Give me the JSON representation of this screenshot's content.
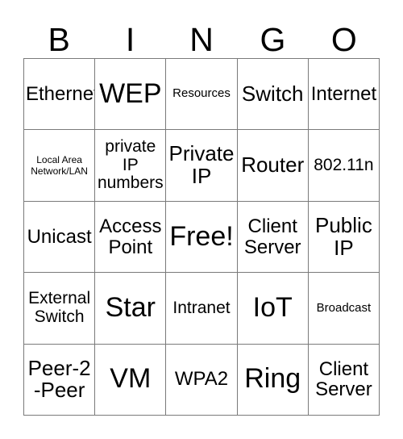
{
  "card": {
    "title_letters": [
      "B",
      "I",
      "N",
      "G",
      "O"
    ],
    "columns": 5,
    "rows": 5,
    "free_space_label": "Free!",
    "grid": [
      [
        {
          "text": "Ethernet",
          "size": "fs-lg"
        },
        {
          "text": "WEP",
          "size": "fs-xxl"
        },
        {
          "text": "Resources",
          "size": "fs-sm"
        },
        {
          "text": "Switch",
          "size": "fs-xl"
        },
        {
          "text": "Internet",
          "size": "fs-lg"
        }
      ],
      [
        {
          "text": "Local Area\nNetwork/LAN",
          "size": "fs-xs"
        },
        {
          "text": "private\nIP\nnumbers",
          "size": "fs-md"
        },
        {
          "text": "Private\nIP",
          "size": "fs-xl"
        },
        {
          "text": "Router",
          "size": "fs-xl"
        },
        {
          "text": "802.11n",
          "size": "fs-md"
        }
      ],
      [
        {
          "text": "Unicast",
          "size": "fs-lg"
        },
        {
          "text": "Access\nPoint",
          "size": "fs-lg"
        },
        {
          "text": "Free!",
          "size": "fs-xxl"
        },
        {
          "text": "Client\nServer",
          "size": "fs-lg"
        },
        {
          "text": "Public\nIP",
          "size": "fs-xl"
        }
      ],
      [
        {
          "text": "External\nSwitch",
          "size": "fs-md"
        },
        {
          "text": "Star",
          "size": "fs-xxl"
        },
        {
          "text": "Intranet",
          "size": "fs-md"
        },
        {
          "text": "IoT",
          "size": "fs-xxl"
        },
        {
          "text": "Broadcast",
          "size": "fs-sm"
        }
      ],
      [
        {
          "text": "Peer-2\n-Peer",
          "size": "fs-xl"
        },
        {
          "text": "VM",
          "size": "fs-xxl"
        },
        {
          "text": "WPA2",
          "size": "fs-lg"
        },
        {
          "text": "Ring",
          "size": "fs-xxl"
        },
        {
          "text": "Client\nServer",
          "size": "fs-lg"
        }
      ]
    ]
  },
  "colors": {
    "background": "#ffffff",
    "text": "#000000",
    "grid_line": "#7a7a7a"
  }
}
